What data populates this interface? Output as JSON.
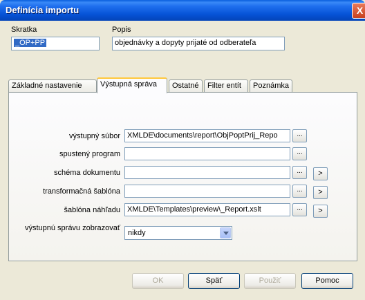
{
  "window": {
    "title": "Definícia importu",
    "close_label": "X"
  },
  "header": {
    "shortcut_label": "Skratka",
    "shortcut_value": "_OP+PP",
    "description_label": "Popis",
    "description_value": "objednávky a dopyty prijaté od odberateľa"
  },
  "tabs": [
    {
      "label": "Základné nastavenie"
    },
    {
      "label": "Výstupná správa"
    },
    {
      "label": "Ostatné"
    },
    {
      "label": "Filter entít"
    },
    {
      "label": "Poznámka"
    }
  ],
  "form": {
    "rows": [
      {
        "label": "výstupný súbor",
        "value": "XMLDE\\documents\\report\\ObjPoptPrij_Repo"
      },
      {
        "label": "spustený program",
        "value": ""
      },
      {
        "label": "schéma dokumentu",
        "value": ""
      },
      {
        "label": "transformačná šablóna",
        "value": ""
      },
      {
        "label": "šablóna náhľadu",
        "value": "XMLDE\\Templates\\preview\\_Report.xslt"
      }
    ],
    "browse_label": "...",
    "arrow_label": ">",
    "display_label": "výstupnú správu zobrazovať",
    "display_value": "nikdy"
  },
  "buttons": {
    "ok": "OK",
    "back": "Späť",
    "apply": "Použiť",
    "help": "Pomoc"
  }
}
